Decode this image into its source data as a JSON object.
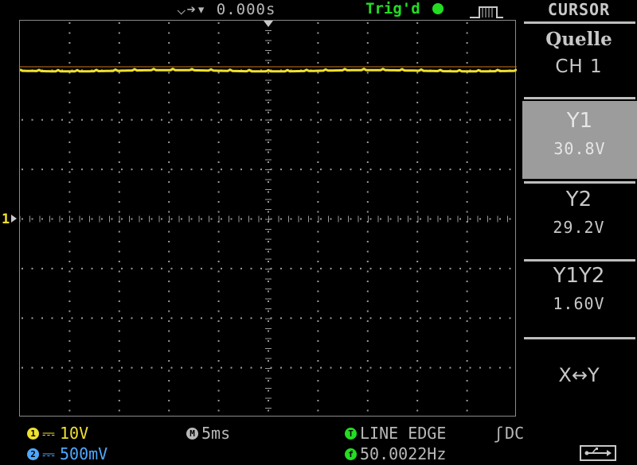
{
  "top": {
    "time_offset": "0.000s",
    "trigger_status": "Trig'd"
  },
  "screen": {
    "trace_color": "#f0e030",
    "channel_marker": "1"
  },
  "panel": {
    "title": "CURSOR",
    "source_label": "Quelle",
    "source_value": "CH 1",
    "y1_label": "Y1",
    "y1_value": "30.8V",
    "y2_label": "Y2",
    "y2_value": "29.2V",
    "delta_label": "Y1Y2",
    "delta_value": "1.60V",
    "swap_label": "X↔Y"
  },
  "bottom": {
    "ch1_scale": "10V",
    "ch2_scale": "500mV",
    "timebase": "5ms",
    "trigger_mode": "LINE EDGE",
    "coupling": "DC",
    "frequency": "50.0022Hz",
    "ch1_num": "1",
    "ch2_num": "2",
    "time_icon": "M",
    "trig_icon": "T",
    "freq_icon": "f"
  }
}
